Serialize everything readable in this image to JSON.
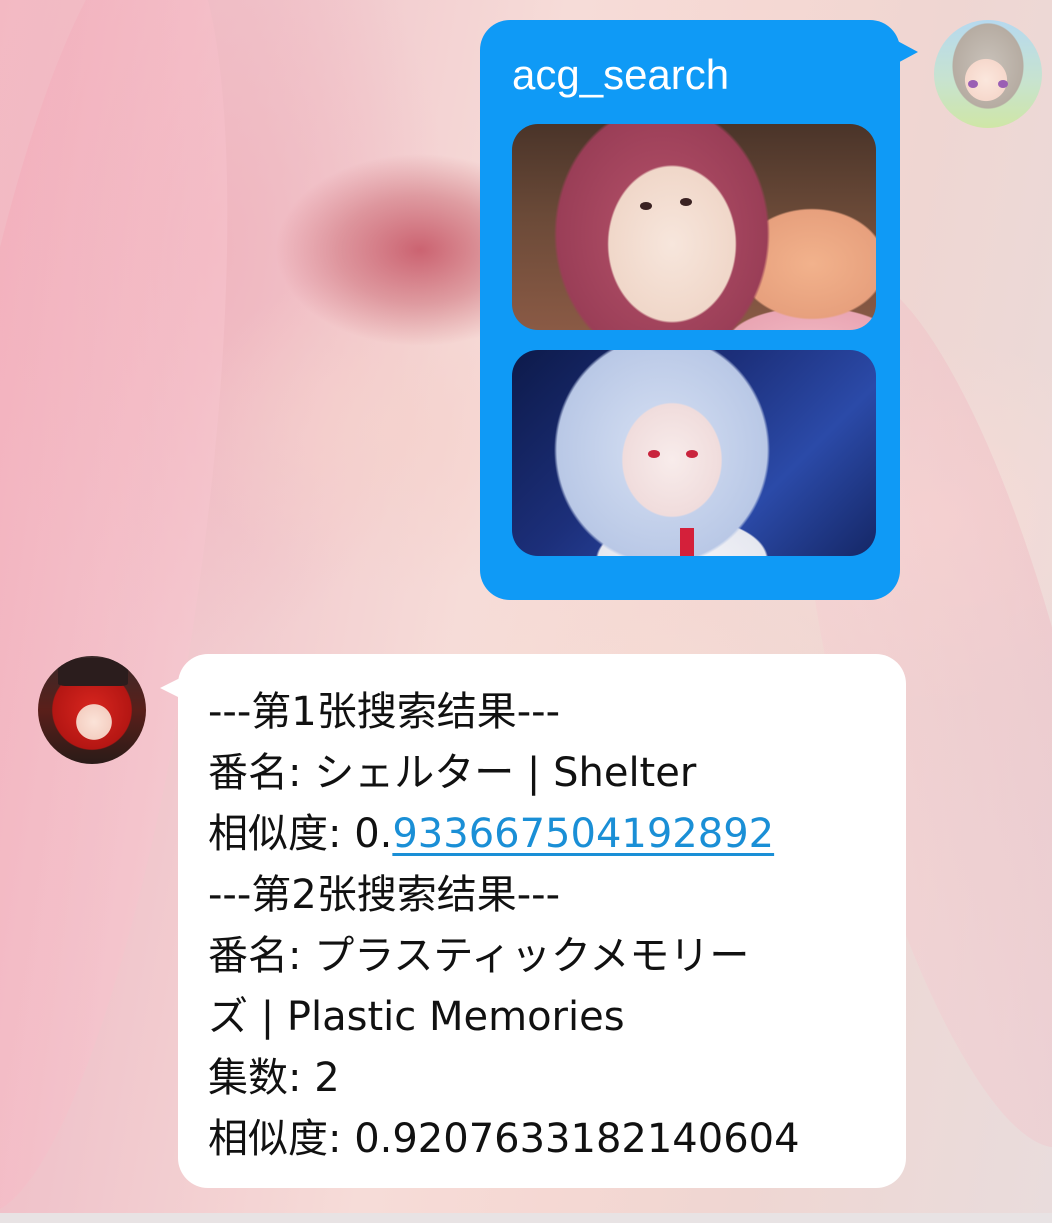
{
  "conversation": {
    "outgoing": {
      "command_text": "acg_search",
      "images": [
        {
          "name": "search-image-1",
          "description_icon": "anime-girl-yawning-image"
        },
        {
          "name": "search-image-2",
          "description_icon": "anime-girl-silver-hair-image"
        }
      ]
    },
    "incoming": {
      "lines": [
        {
          "text": "---第1张搜索结果---"
        },
        {
          "text": "番名: シェルター | Shelter"
        },
        {
          "prefix": "相似度: 0.",
          "link": "933667504192892"
        },
        {
          "text": "---第2张搜索结果---"
        },
        {
          "text": "番名: プラスティックメモリー"
        },
        {
          "text": "ズ | Plastic Memories"
        },
        {
          "text": "集数: 2"
        },
        {
          "text": "相似度: 0.9207633182140604"
        }
      ]
    }
  },
  "colors": {
    "outgoing_bubble": "#0f9af6",
    "incoming_bubble": "#ffffff",
    "link": "#1a8fd6",
    "text": "#111111"
  }
}
